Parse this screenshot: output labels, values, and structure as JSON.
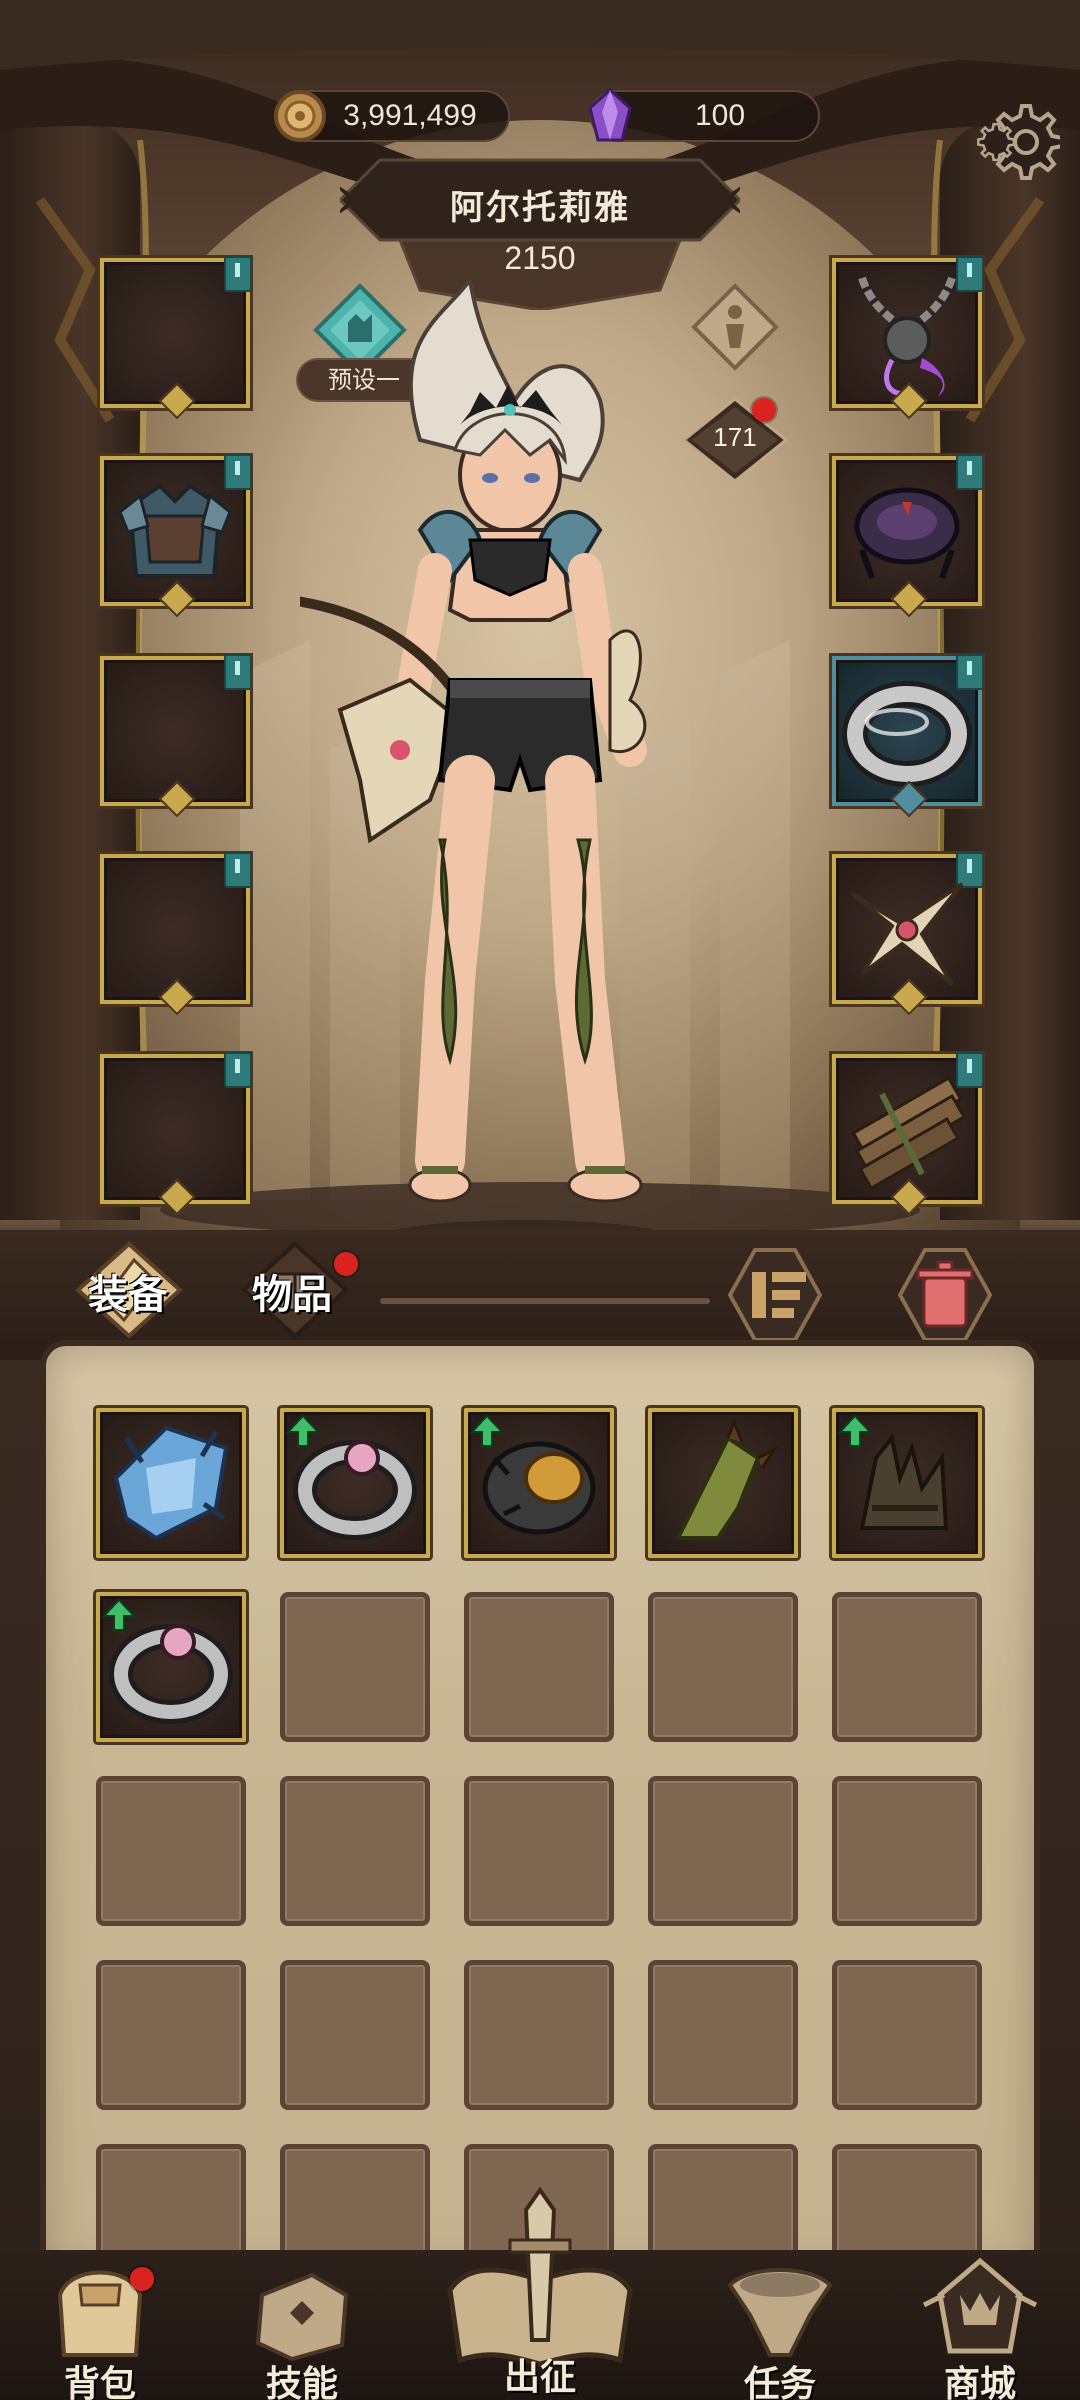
{
  "currency": {
    "gold": "3,991,499",
    "gems": "100"
  },
  "hero": {
    "name": "阿尔托莉雅",
    "power": "2150",
    "preset_label": "预设一",
    "level": "171"
  },
  "equip_slots": {
    "left": [
      {
        "id": "left-1",
        "icon": "empty-slot",
        "equipped": false
      },
      {
        "id": "left-2",
        "icon": "chest-armor-icon",
        "equipped": true
      },
      {
        "id": "left-3",
        "icon": "empty-slot",
        "equipped": false
      },
      {
        "id": "left-4",
        "icon": "empty-slot",
        "equipped": false
      },
      {
        "id": "left-5",
        "icon": "empty-slot",
        "equipped": false
      }
    ],
    "right": [
      {
        "id": "right-1",
        "icon": "chain-amulet-icon",
        "equipped": true
      },
      {
        "id": "right-2",
        "icon": "dark-bracer-icon",
        "equipped": true
      },
      {
        "id": "right-3",
        "icon": "silver-ring-icon",
        "equipped": true
      },
      {
        "id": "right-4",
        "icon": "ornate-crossguard-icon",
        "equipped": true
      },
      {
        "id": "right-5",
        "icon": "bound-planks-icon",
        "equipped": true
      }
    ]
  },
  "tabs": {
    "equip": "装备",
    "items": "物品"
  },
  "inventory": {
    "items": [
      {
        "icon": "blue-crystal-armor-icon",
        "upgrade": false
      },
      {
        "icon": "pink-gem-ring-icon",
        "upgrade": true
      },
      {
        "icon": "amber-stone-bracelet-icon",
        "upgrade": true
      },
      {
        "icon": "thorny-vine-gauntlet-icon",
        "upgrade": false
      },
      {
        "icon": "spiked-boots-icon",
        "upgrade": true
      },
      {
        "icon": "pink-gem-ring-icon",
        "upgrade": true
      }
    ],
    "visible_cells": 25
  },
  "bottom_nav": {
    "bag": "背包",
    "skills": "技能",
    "expedition": "出征",
    "quests": "任务",
    "shop": "商城"
  },
  "colors": {
    "gold_border": "#c9a94d",
    "teal_tag": "#2f7b7a",
    "notification_red": "#d8231f",
    "panel_bg": "#c9b794"
  }
}
